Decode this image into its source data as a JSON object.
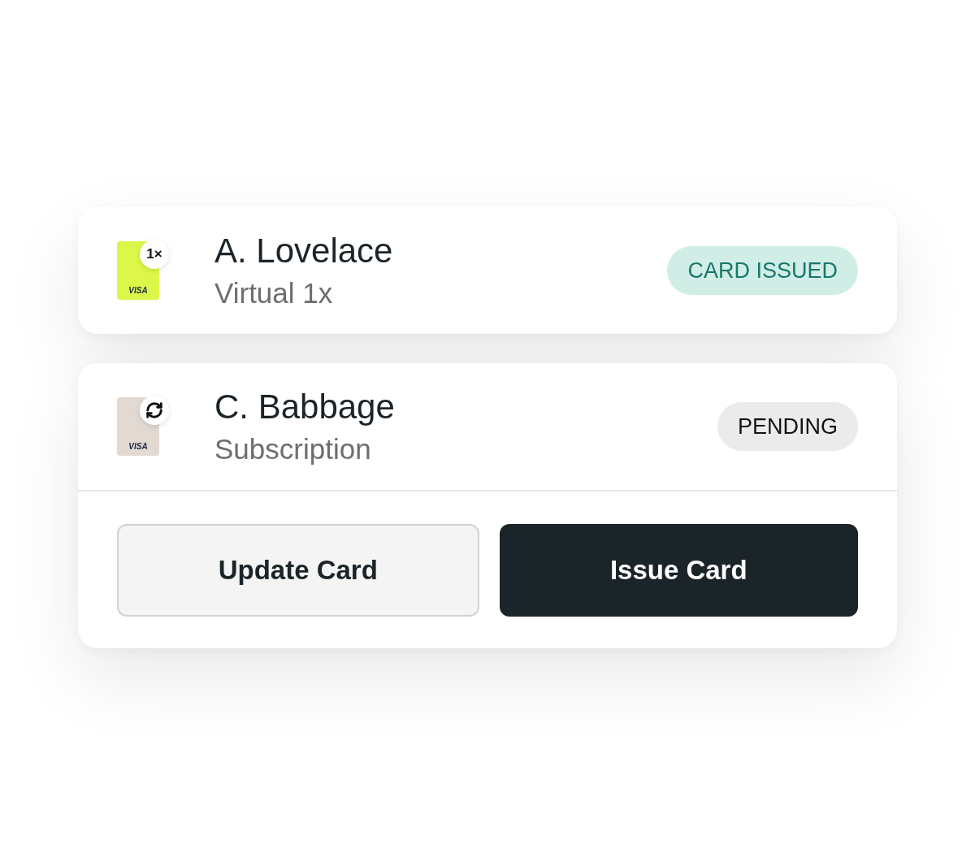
{
  "items": [
    {
      "name": "A. Lovelace",
      "subtitle": "Virtual 1x",
      "thumbnail": {
        "color": "#dcf64a",
        "network": "VISA",
        "badge": {
          "kind": "text",
          "label": "1×"
        }
      },
      "status": {
        "kind": "issued",
        "label": "CARD ISSUED"
      }
    },
    {
      "name": "C. Babbage",
      "subtitle": "Subscription",
      "thumbnail": {
        "color": "#e2d9d2",
        "network": "VISA",
        "badge": {
          "kind": "recurring"
        }
      },
      "status": {
        "kind": "pending",
        "label": "PENDING"
      },
      "actions": [
        {
          "kind": "secondary",
          "label": "Update Card"
        },
        {
          "kind": "primary",
          "label": "Issue Card"
        }
      ]
    }
  ]
}
